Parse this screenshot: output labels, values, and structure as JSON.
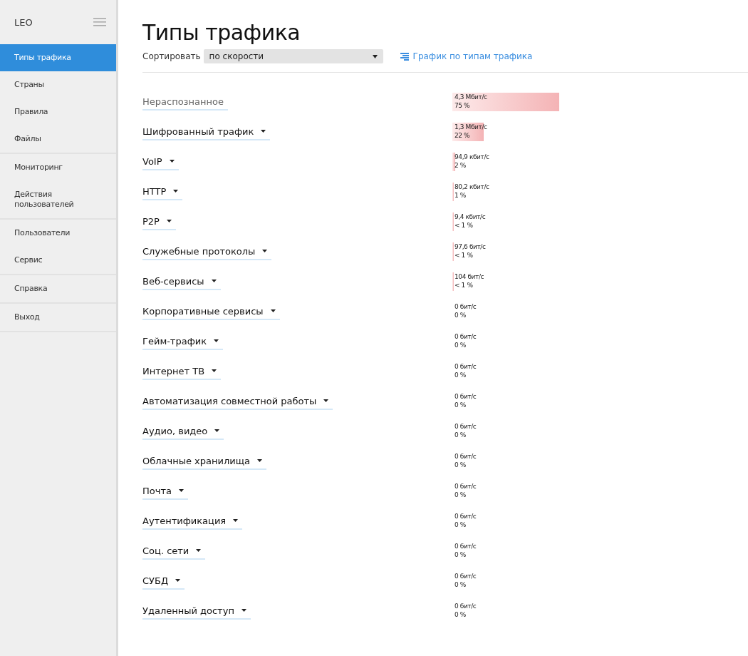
{
  "sidebar": {
    "logo": "LEO",
    "groups": [
      {
        "items": [
          {
            "label": "Типы трафика",
            "selected": true
          },
          {
            "label": "Страны",
            "selected": false
          },
          {
            "label": "Правила",
            "selected": false
          },
          {
            "label": "Файлы",
            "selected": false
          }
        ]
      },
      {
        "items": [
          {
            "label": "Мониторинг",
            "selected": false
          },
          {
            "label": "Действия пользователей",
            "selected": false
          }
        ]
      },
      {
        "items": [
          {
            "label": "Пользователи",
            "selected": false
          },
          {
            "label": "Сервис",
            "selected": false
          }
        ]
      },
      {
        "items": [
          {
            "label": "Справка",
            "selected": false
          }
        ]
      },
      {
        "items": [
          {
            "label": "Выход",
            "selected": false
          }
        ]
      }
    ]
  },
  "title": "Типы трафика",
  "sort": {
    "label": "Сортировать",
    "value": "по скорости"
  },
  "chart_link": "График по типам трафика",
  "rows": [
    {
      "name": "Нераспознанное",
      "kind": "plain",
      "speed": "4,3 Мбит/с",
      "share": "75 %"
    },
    {
      "name": "Шифрованный трафик",
      "kind": "menu",
      "speed": "1,3 Мбит/с",
      "share": "22 %"
    },
    {
      "name": "VoIP",
      "kind": "menu",
      "speed": "94,9 кбит/с",
      "share": "2 %"
    },
    {
      "name": "HTTP",
      "kind": "menu",
      "speed": "80,2 кбит/с",
      "share": "1 %"
    },
    {
      "name": "P2P",
      "kind": "menu",
      "speed": "9,4 кбит/с",
      "share": "< 1 %"
    },
    {
      "name": "Служебные протоколы",
      "kind": "menu",
      "speed": "97,6 бит/с",
      "share": "< 1 %"
    },
    {
      "name": "Веб-сервисы",
      "kind": "menu",
      "speed": "104 бит/с",
      "share": "< 1 %"
    },
    {
      "name": "Корпоративные сервисы",
      "kind": "menu",
      "speed": "0 бит/с",
      "share": "0 %"
    },
    {
      "name": "Гейм-трафик",
      "kind": "menu",
      "speed": "0 бит/с",
      "share": "0 %"
    },
    {
      "name": "Интернет ТВ",
      "kind": "menu",
      "speed": "0 бит/с",
      "share": "0 %"
    },
    {
      "name": "Автоматизация совместной работы",
      "kind": "menu",
      "speed": "0 бит/с",
      "share": "0 %"
    },
    {
      "name": "Аудио, видео",
      "kind": "menu",
      "speed": "0 бит/с",
      "share": "0 %"
    },
    {
      "name": "Облачные хранилища",
      "kind": "menu",
      "speed": "0 бит/с",
      "share": "0 %"
    },
    {
      "name": "Почта",
      "kind": "menu",
      "speed": "0 бит/с",
      "share": "0 %"
    },
    {
      "name": "Аутентификация",
      "kind": "menu",
      "speed": "0 бит/с",
      "share": "0 %"
    },
    {
      "name": "Соц. сети",
      "kind": "menu",
      "speed": "0 бит/с",
      "share": "0 %"
    },
    {
      "name": "СУБД",
      "kind": "menu",
      "speed": "0 бит/с",
      "share": "0 %"
    },
    {
      "name": "Удаленный доступ",
      "kind": "menu",
      "speed": "0 бит/с",
      "share": "0 %"
    }
  ]
}
